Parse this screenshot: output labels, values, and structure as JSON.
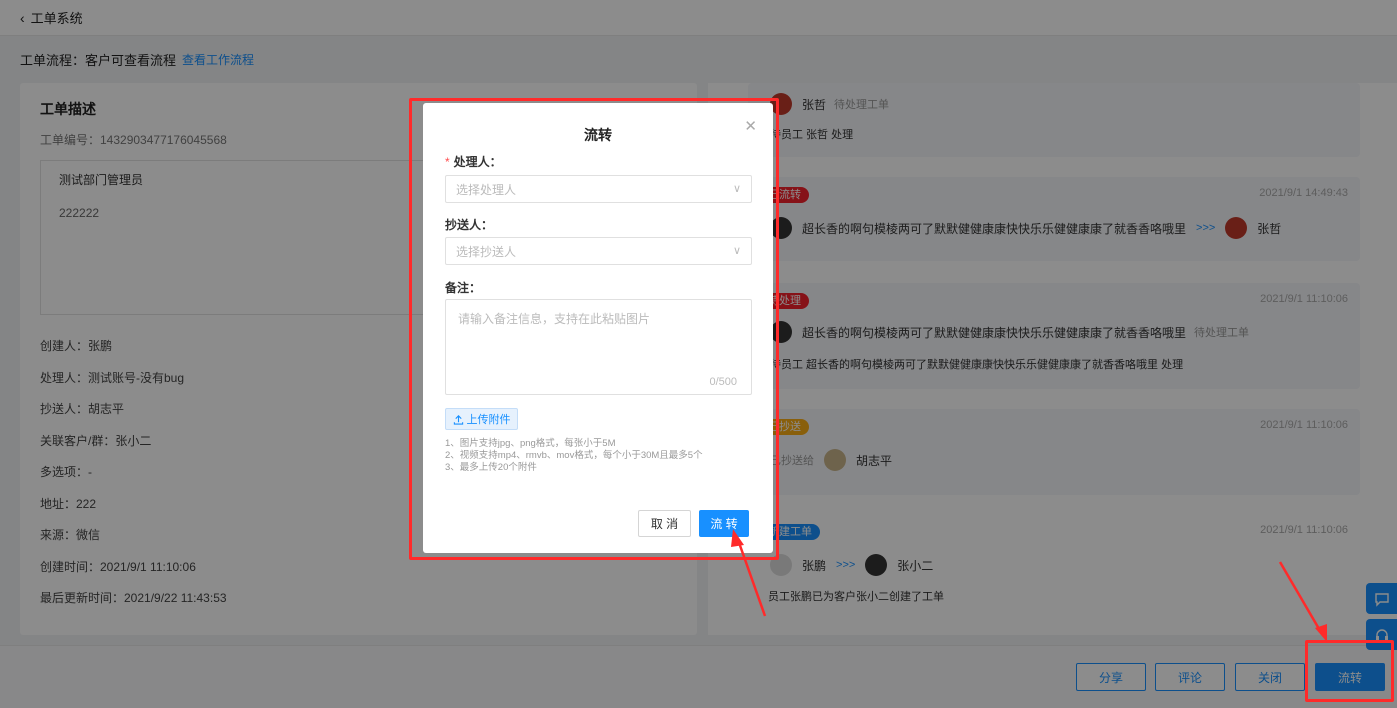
{
  "header": {
    "back_icon": "chevron-left-icon",
    "title": "工单系统"
  },
  "flow": {
    "label": "工单流程：客户可查看流程",
    "link": "查看工作流程"
  },
  "left": {
    "title": "工单描述",
    "number": "工单编号：1432903477176045568",
    "desc_title": "测试部门管理员",
    "desc_body": "222222",
    "info": [
      "创建人：张鹏",
      "处理人：测试账号-没有bug",
      "抄送人：胡志平",
      "关联客户/群：张小二",
      "多选项：-",
      "地址：222",
      "来源：微信",
      "创建时间：2021/9/1 11:10:06",
      "最后更新时间：2021/9/22 11:43:53"
    ]
  },
  "timeline": {
    "card1": {
      "name": "张哲",
      "status": "待处理工单",
      "line": "待员工 张哲 处理"
    },
    "card2": {
      "tag": "已流转",
      "tag_color": "#f5222d",
      "time": "2021/9/1 14:49:43",
      "text": "超长香的啊句模棱两可了默默健健康康快快乐乐健健康康了就香香咯哦里",
      "arrow": ">>>",
      "to": "张哲"
    },
    "card3": {
      "tag": "待处理",
      "tag_color": "#f5222d",
      "time": "2021/9/1 11:10:06",
      "text": "超长香的啊句模棱两可了默默健健康康快快乐乐健健康康了就香香咯哦里",
      "status": "待处理工单",
      "line": "待员工 超长香的啊句模棱两可了默默健健康康快快乐乐健健康康了就香香咯哦里 处理"
    },
    "card4": {
      "tag": "已抄送",
      "tag_color": "#faad14",
      "time": "2021/9/1 11:10:06",
      "prefix": "已抄送给",
      "name": "胡志平"
    },
    "card5": {
      "tag": "新建工单",
      "tag_color": "#1890ff",
      "time": "2021/9/1 11:10:06",
      "from": "张鹏",
      "arrow": ">>>",
      "to": "张小二",
      "line": "员工张鹏已为客户张小二创建了工单"
    }
  },
  "bottom": {
    "share": "分享",
    "comment": "评论",
    "close": "关闭",
    "transfer": "流转"
  },
  "float": {
    "chat_icon": "chat-bubble-icon",
    "support_icon": "headset-icon"
  },
  "modal": {
    "title": "流转",
    "close_icon": "close-icon",
    "handler_label": "处理人：",
    "handler_placeholder": "选择处理人",
    "cc_label": "抄送人：",
    "cc_placeholder": "选择抄送人",
    "remark_label": "备注：",
    "remark_placeholder": "请输入备注信息，支持在此粘贴图片",
    "remark_count": "0/500",
    "upload_label": "上传附件",
    "hints": [
      "1、图片支持jpg、png格式，每张小于5M",
      "2、视频支持mp4、rmvb、mov格式，每个小于30M且最多5个",
      "3、最多上传20个附件"
    ],
    "cancel": "取 消",
    "ok": "流 转"
  },
  "colors": {
    "primary": "#1890ff",
    "annotation": "#ff2a2a"
  }
}
